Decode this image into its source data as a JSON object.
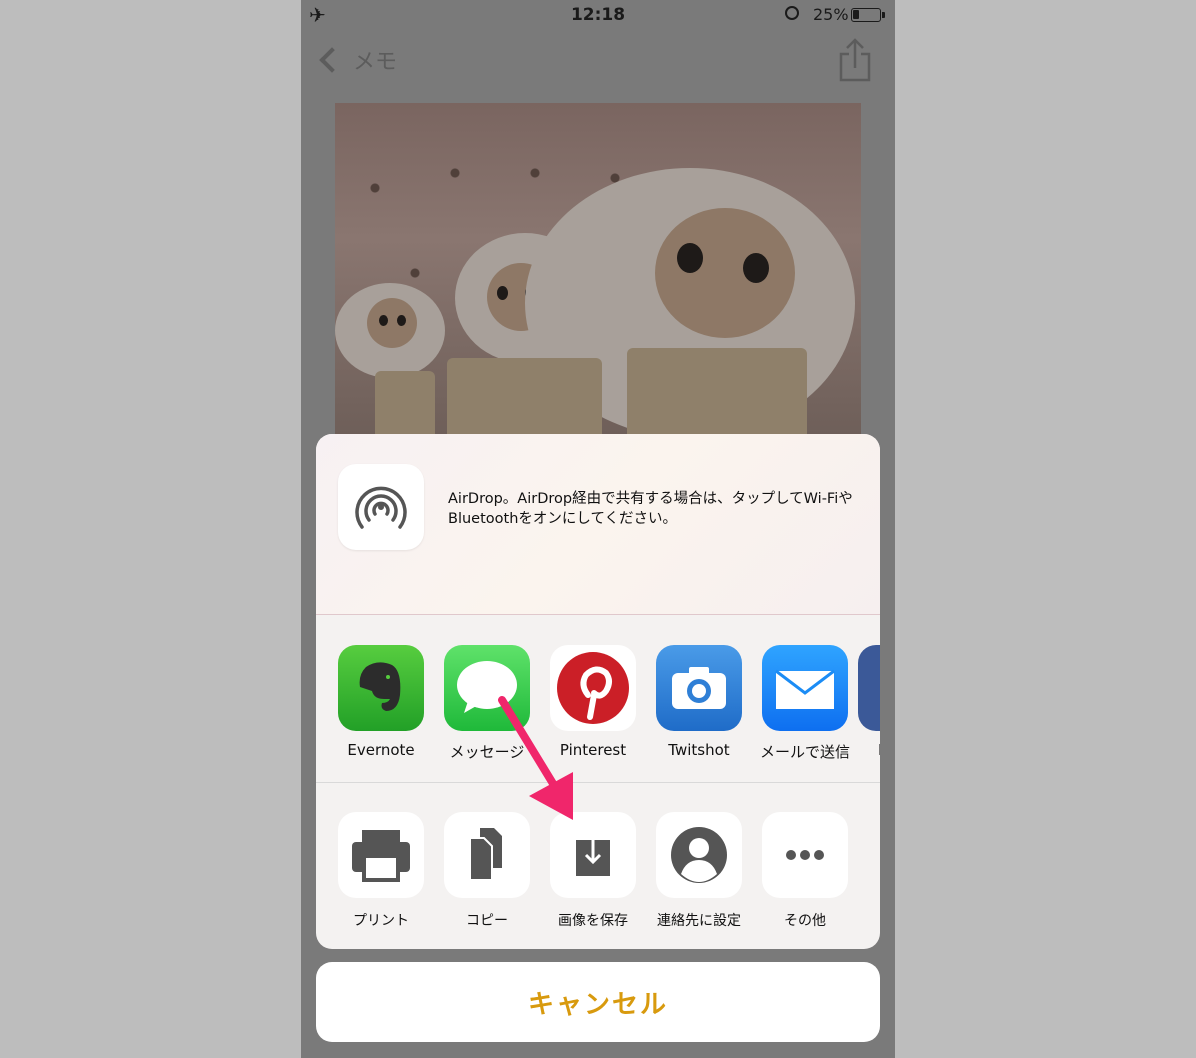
{
  "status": {
    "time": "12:18",
    "battery": "25%",
    "battery_level": 0.25
  },
  "nav": {
    "back_label": "メモ"
  },
  "airdrop": {
    "text": "AirDrop。AirDrop経由で共有する場合は、タップしてWi-FiやBluetoothをオンにしてください。"
  },
  "share_apps": [
    {
      "label": "Evernote",
      "icon": "evernote-icon",
      "color": "#35b42e"
    },
    {
      "label": "メッセージ",
      "icon": "messages-icon",
      "color": "#3ac245"
    },
    {
      "label": "Pinterest",
      "icon": "pinterest-icon",
      "color": "#cb1f27"
    },
    {
      "label": "Twitshot",
      "icon": "camera-icon",
      "color": "#2f7fd6"
    },
    {
      "label": "メールで送信",
      "icon": "mail-icon",
      "color": "#1b8cf5"
    },
    {
      "label": "F",
      "icon": "facebook-icon",
      "color": "#3b5998"
    }
  ],
  "actions": [
    {
      "label": "プリント",
      "icon": "print-icon"
    },
    {
      "label": "コピー",
      "icon": "copy-icon"
    },
    {
      "label": "画像を保存",
      "icon": "save-image-icon"
    },
    {
      "label": "連絡先に設定",
      "icon": "contact-icon"
    },
    {
      "label": "その他",
      "icon": "more-icon"
    }
  ],
  "cancel_label": "キャンセル",
  "colors": {
    "accent": "#d89a0e",
    "arrow": "#f0266b"
  }
}
